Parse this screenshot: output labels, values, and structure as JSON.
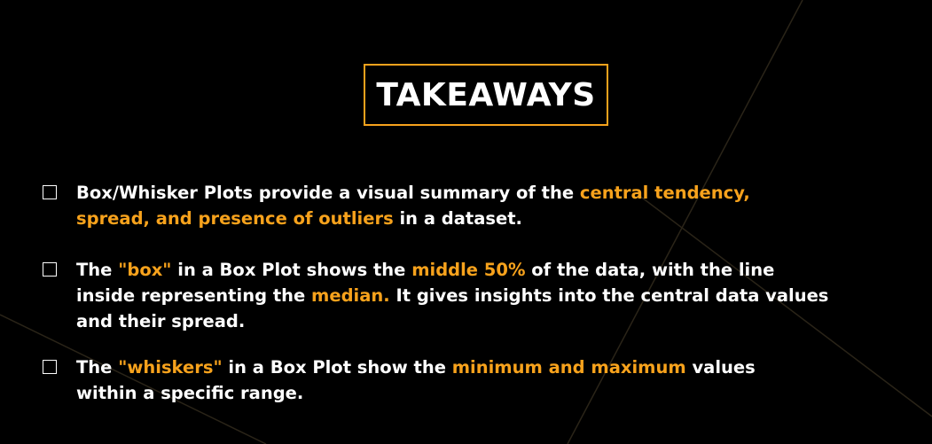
{
  "title": "TAKEAWAYS",
  "colors": {
    "accent": "#f7a21c",
    "background": "#000000",
    "text": "#ffffff"
  },
  "takeaways": [
    {
      "lines": [
        [
          {
            "t": "Box/Whisker Plots provide a visual summary of the "
          },
          {
            "t": "central tendency,",
            "hl": true
          }
        ],
        [
          {
            "t": "spread, and presence of outliers",
            "hl": true
          },
          {
            "t": " in a dataset."
          }
        ]
      ]
    },
    {
      "lines": [
        [
          {
            "t": "The "
          },
          {
            "t": "\"box\"",
            "hl": true
          },
          {
            "t": " in a Box Plot shows the "
          },
          {
            "t": "middle 50%",
            "hl": true
          },
          {
            "t": " of the data, with the line"
          }
        ],
        [
          {
            "t": "inside representing the "
          },
          {
            "t": "median.",
            "hl": true
          },
          {
            "t": " It gives insights into the central data values"
          }
        ],
        [
          {
            "t": "and their spread."
          }
        ]
      ]
    },
    {
      "lines": [
        [
          {
            "t": "The "
          },
          {
            "t": "\"whiskers\"",
            "hl": true
          },
          {
            "t": " in a Box Plot show the "
          },
          {
            "t": "minimum and maximum",
            "hl": true
          },
          {
            "t": " values"
          }
        ],
        [
          {
            "t": "within a specific range."
          }
        ]
      ]
    }
  ]
}
